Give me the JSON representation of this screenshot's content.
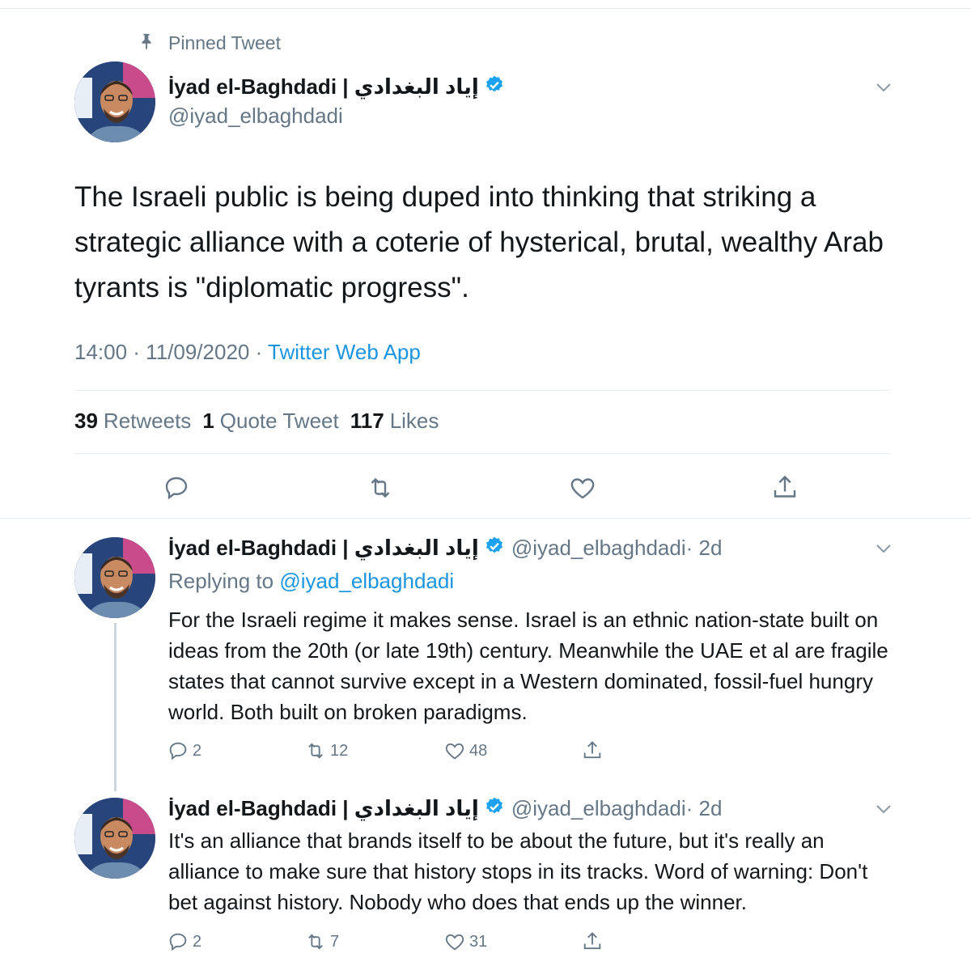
{
  "pinned": {
    "label": "Pinned Tweet",
    "icon": "pin-icon"
  },
  "main_tweet": {
    "author_name": "İyad el-Baghdadi | إياد البغدادي",
    "handle": "@iyad_elbaghdadi",
    "text": "The Israeli public is being duped into thinking that striking a strategic alliance with a coterie of hysterical, brutal, wealthy Arab tyrants is \"diplomatic progress\".",
    "time": "14:00 · 11/09/2020 · ",
    "source": "Twitter Web App",
    "stats": {
      "retweets_count": "39",
      "retweets_label": "Retweets",
      "quotes_count": "1",
      "quotes_label": "Quote Tweet",
      "likes_count": "117",
      "likes_label": "Likes"
    }
  },
  "replies": [
    {
      "author_name": "İyad el-Baghdadi | إياد البغدادي",
      "handle": "@iyad_elbaghdadi",
      "time": "· 2d",
      "replying_prefix": "Replying to ",
      "replying_to": "@iyad_elbaghdadi",
      "text": "For the Israeli regime it makes sense. Israel is an ethnic nation-state built on ideas from the 20th (or late 19th) century. Meanwhile the UAE et al are fragile states that cannot survive except in a Western dominated, fossil-fuel hungry world. Both built on broken paradigms.",
      "replies_count": "2",
      "retweets_count": "12",
      "likes_count": "48"
    },
    {
      "author_name": "İyad el-Baghdadi | إياد البغدادي",
      "handle": "@iyad_elbaghdadi",
      "time": "· 2d",
      "text": "It's an alliance that brands itself to be about the future, but it's really an alliance to make sure that history stops in its tracks. Word of warning: Don't bet against history. Nobody who does that ends up the winner.",
      "replies_count": "2",
      "retweets_count": "7",
      "likes_count": "31"
    }
  ],
  "colors": {
    "link": "#1b95e0",
    "muted": "#657786",
    "text": "#14171a",
    "divider": "#e6ecf0",
    "verified": "#1da1f2"
  }
}
